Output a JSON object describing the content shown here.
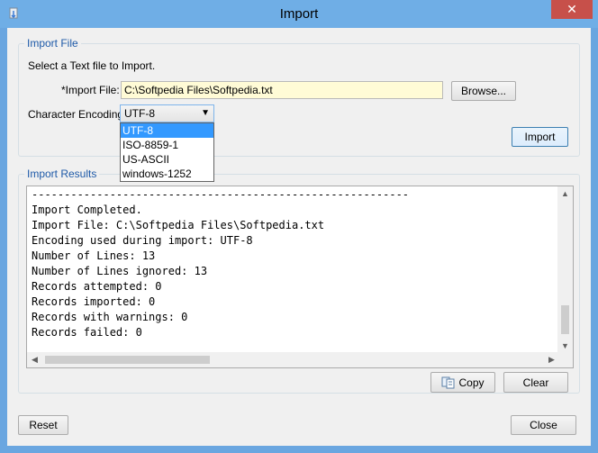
{
  "window": {
    "title": "Import",
    "close_glyph": "✕",
    "icon": "app-icon"
  },
  "import_file": {
    "legend": "Import File",
    "instruction": "Select a Text file to Import.",
    "file_label": "*Import File:",
    "file_value": "C:\\Softpedia Files\\Softpedia.txt",
    "browse_label": "Browse...",
    "encoding_label": "Character Encoding:",
    "encoding_selected": "UTF-8",
    "encoding_options": [
      "UTF-8",
      "ISO-8859-1",
      "US-ASCII",
      "windows-1252"
    ],
    "import_label": "Import"
  },
  "results": {
    "legend": "Import Results",
    "text": "----------------------------------------------------------\nImport Completed.\nImport File: C:\\Softpedia Files\\Softpedia.txt\nEncoding used during import: UTF-8\nNumber of Lines: 13\nNumber of Lines ignored: 13\nRecords attempted: 0\nRecords imported: 0\nRecords with warnings: 0\nRecords failed: 0",
    "copy_label": "Copy",
    "clear_label": "Clear"
  },
  "footer": {
    "reset_label": "Reset",
    "close_label": "Close"
  }
}
